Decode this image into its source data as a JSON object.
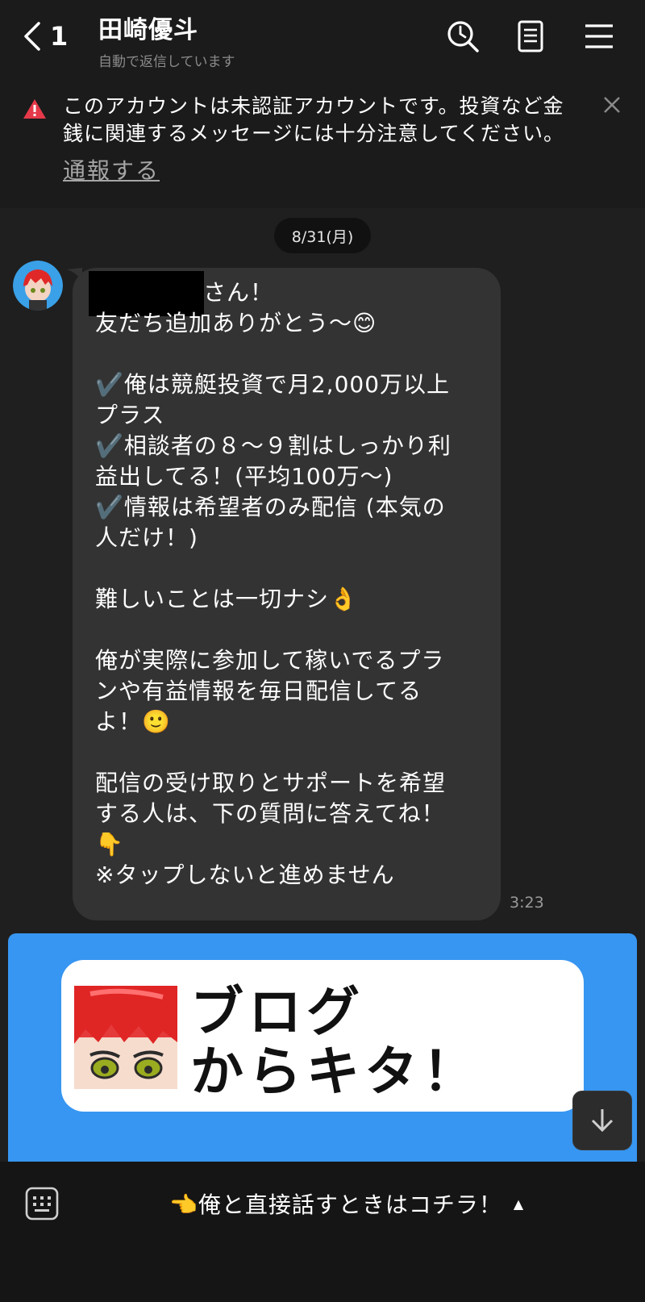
{
  "header": {
    "back_count": "1",
    "title": "田崎優斗",
    "subtitle": "自動で返信しています",
    "icons": [
      "back-chevron-icon",
      "search-icon",
      "notes-icon",
      "menu-icon"
    ]
  },
  "warning": {
    "icon": "warning-icon",
    "line1": "このアカウントは未認証アカウントです。投資など金",
    "line2": "銭に関連するメッセージには十分注意してください。",
    "report_link": "通報する",
    "close_icon": "close-icon",
    "accent_color": "#e5394a"
  },
  "chat": {
    "date": "8/31(月)",
    "message": {
      "lines": [
        "さん！",
        "友だち追加ありがとう〜😊",
        "",
        "✔️俺は競艇投資で月2,000万以上",
        "プラス",
        "✔️相談者の８〜９割はしっかり利",
        "益出してる！(平均100万〜)",
        "✔️情報は希望者のみ配信 (本気の",
        "人だけ！)",
        "",
        "難しいことは一切ナシ👌",
        "",
        "俺が実際に参加して稼いでるプラ",
        "ンや有益情報を毎日配信してる",
        "よ！🙂",
        "",
        "配信の受け取りとサポートを希望",
        "する人は、下の質問に答えてね！",
        "👇",
        "※タップしないと進めません"
      ],
      "time": "3:23"
    }
  },
  "promo": {
    "title_line1": "ブログ",
    "title_line2": "からキタ！",
    "bg_color": "#3796f1"
  },
  "bottom_bar": {
    "keyboard_icon": "keyboard-icon",
    "menu_label": "👈俺と直接話すときはコチラ！",
    "caret": "▲"
  }
}
